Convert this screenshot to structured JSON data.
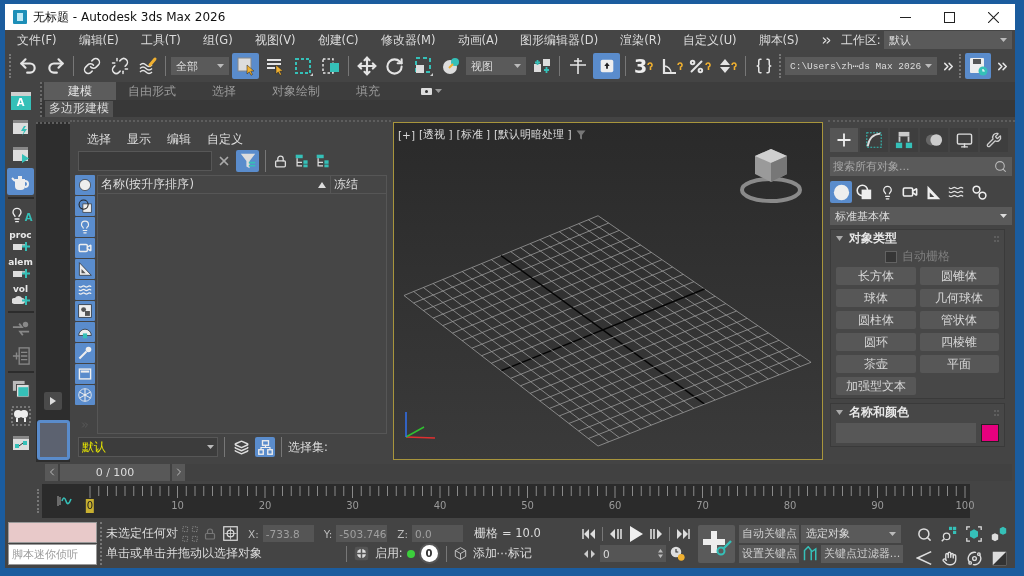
{
  "window": {
    "title": "无标题 - Autodesk 3ds Max 2026"
  },
  "menu": {
    "items": [
      "文件(F)",
      "编辑(E)",
      "工具(T)",
      "组(G)",
      "视图(V)",
      "创建(C)",
      "修改器(M)",
      "动画(A)",
      "图形编辑器(D)",
      "渲染(R)",
      "自定义(U)",
      "脚本(S)"
    ],
    "workspace": {
      "label": "工作区:",
      "value": "默认"
    }
  },
  "main_toolbar": {
    "selection_filter": "全部",
    "reference_coordinate": "视图",
    "snap_label": "3",
    "project_path": "C:\\Users\\zh⋯ds Max 2026",
    "buttons": [
      {
        "selected": false
      },
      {
        "selected": false
      },
      {
        "selected": false
      },
      {
        "selected": false
      },
      {
        "selected": false
      },
      {
        "selected": true
      },
      {
        "selected": false
      },
      {
        "selected": false
      },
      {
        "selected": false
      },
      {
        "selected": false
      },
      {
        "selected": false
      },
      {
        "selected": false
      },
      {
        "selected": false
      },
      {
        "selected": false
      },
      {
        "selected": false
      },
      {
        "selected": true
      },
      {
        "selected": false
      },
      {
        "selected": false
      },
      {
        "selected": false
      },
      {
        "selected": false
      },
      {
        "selected": false
      },
      {
        "selected": false
      },
      {
        "selected": true
      },
      {
        "selected": false
      }
    ]
  },
  "ribbon": {
    "tabs": [
      {
        "label": "建模",
        "selected": true
      },
      {
        "label": "自由形式",
        "selected": false
      },
      {
        "label": "选择",
        "selected": false
      },
      {
        "label": "对象绘制",
        "selected": false
      },
      {
        "label": "填充",
        "selected": false
      }
    ],
    "panels": [
      "多边形建模"
    ]
  },
  "side_toolbar": {
    "buttons": [
      {
        "label": "A",
        "selected": false
      },
      {
        "selected": false
      },
      {
        "selected": false
      },
      {
        "selected": true
      },
      {
        "label": "A",
        "selected": false
      },
      {
        "label": "proc",
        "selected": false
      },
      {
        "label": "alem",
        "selected": false
      },
      {
        "label": "vol",
        "selected": false
      },
      {
        "selected": false
      },
      {
        "selected": false
      },
      {
        "selected": false
      },
      {
        "selected": false
      },
      {
        "selected": false
      }
    ]
  },
  "layout_tab": {
    "selected": true
  },
  "scene_explorer": {
    "menu": [
      "选择",
      "显示",
      "编辑",
      "自定义"
    ],
    "tools": [
      {
        "selected": true
      },
      {
        "selected": false
      },
      {
        "selected": false
      },
      {
        "selected": false
      }
    ],
    "type_filters": [
      {
        "selected": true
      },
      {
        "selected": true
      },
      {
        "selected": true
      },
      {
        "selected": true
      },
      {
        "selected": true
      },
      {
        "selected": true
      },
      {
        "selected": true
      },
      {
        "selected": true
      },
      {
        "selected": true
      },
      {
        "selected": true
      },
      {
        "selected": true
      }
    ],
    "columns": [
      {
        "label": "名称(按升序排序)",
        "sort_ascending": true
      },
      {
        "label": "冻结"
      }
    ],
    "layer": "默认",
    "bottom_tools": [
      {
        "selected": false
      },
      {
        "selected": true
      }
    ],
    "selection_set_label": "选择集:"
  },
  "viewport": {
    "active": true,
    "labels": [
      "[+]",
      "[透视 ]",
      "[标准 ]",
      "[默认明暗处理 ]"
    ]
  },
  "command_panel": {
    "tabs": [
      {
        "selected": true
      },
      {
        "selected": false
      },
      {
        "selected": false
      },
      {
        "selected": false
      },
      {
        "selected": false
      },
      {
        "selected": false
      }
    ],
    "search": {
      "placeholder": "搜索所有对象..."
    },
    "categories": [
      {
        "selected": true
      },
      {
        "selected": false
      },
      {
        "selected": false
      },
      {
        "selected": false
      },
      {
        "selected": false
      },
      {
        "selected": false
      },
      {
        "selected": false
      }
    ],
    "category": "标准基本体",
    "rollouts": [
      {
        "kind": "object_type",
        "title": "对象类型",
        "expanded": true,
        "autogrid": {
          "label": "自动栅格",
          "checked": false,
          "disabled": true
        },
        "buttons": [
          "长方体",
          "圆锥体",
          "球体",
          "几何球体",
          "圆柱体",
          "管状体",
          "圆环",
          "四棱锥",
          "茶壶",
          "平面",
          "加强型文本"
        ]
      },
      {
        "kind": "name_color",
        "title": "名称和颜色",
        "expanded": true,
        "color": "#e6007e"
      }
    ]
  },
  "time_slider": {
    "label": "0 / 100",
    "level": 0
  },
  "track_bar": {
    "labels": [
      {
        "text": "0",
        "current": true
      },
      {
        "text": "10",
        "current": false
      },
      {
        "text": "20",
        "current": false
      },
      {
        "text": "30",
        "current": false
      },
      {
        "text": "40",
        "current": false
      },
      {
        "text": "50",
        "current": false
      },
      {
        "text": "60",
        "current": false
      },
      {
        "text": "70",
        "current": false
      },
      {
        "text": "80",
        "current": false
      },
      {
        "text": "90",
        "current": false
      },
      {
        "text": "100",
        "current": false
      }
    ]
  },
  "status": {
    "listener": {
      "placeholder": "脚本迷你侦听"
    },
    "selection_info": "未选定任何对",
    "prompt": "单击或单击并拖动以选择对象",
    "transform_type_in": {
      "disabled": true,
      "fields": [
        {
          "axis": "X:",
          "value": "-733.8"
        },
        {
          "axis": "Y:",
          "value": "-503.746"
        },
        {
          "axis": "Z:",
          "value": "0.0"
        }
      ]
    },
    "grid": "栅格 = 10.0",
    "adaptive": {
      "label": "启用:",
      "on": true,
      "count": "0"
    },
    "add_tag": "添加⋯标记"
  },
  "playback": {
    "frame": "0"
  },
  "keys": {
    "auto_key": {
      "label": "自动关键点",
      "on": false
    },
    "set_key": "设置关键点",
    "key_mode": "选定对象",
    "key_filters": "关键点过滤器..."
  }
}
